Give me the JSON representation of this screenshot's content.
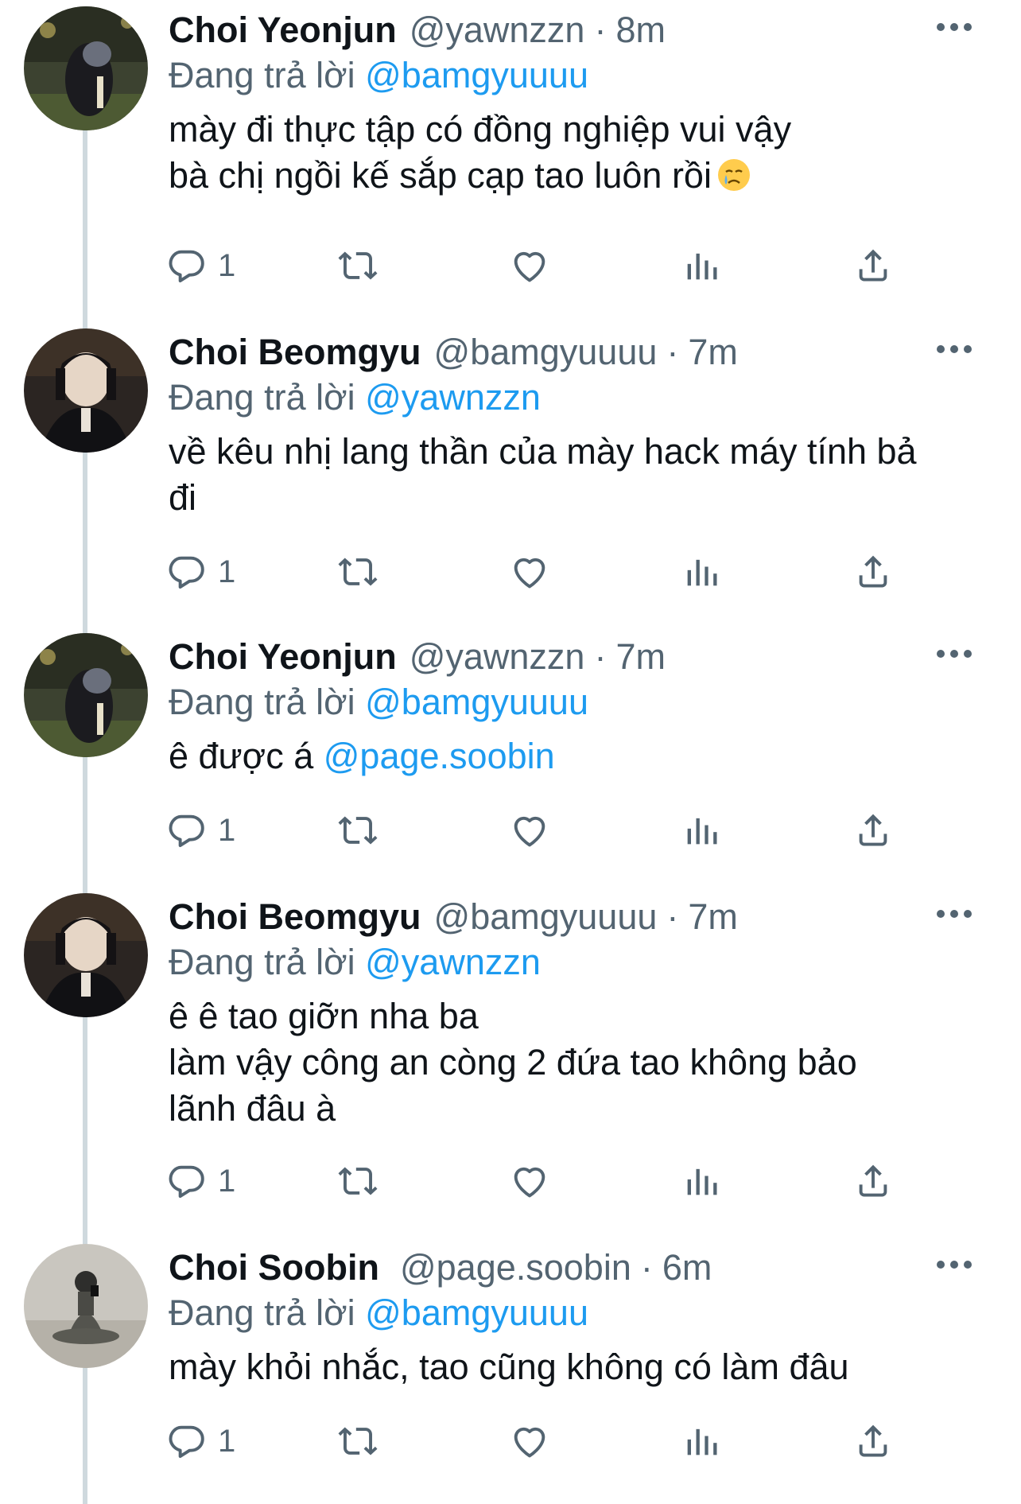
{
  "tweets": [
    {
      "name": "Choi Yeonjun",
      "handle": "@yawnzzn",
      "time": "8m",
      "reply_prefix": "Đang trả lời",
      "reply_to": "@bamgyuuuu",
      "lines": [
        "mày đi thực tập có đồng nghiệp vui vậy",
        "bà chị ngồi kế sắp cạp tao luôn rồi"
      ],
      "emoji": "crying-face",
      "replies": "1",
      "avatar": "yeonjun-avatar"
    },
    {
      "name": "Choi Beomgyu",
      "handle": "@bamgyuuuu",
      "time": "7m",
      "reply_prefix": "Đang trả lời",
      "reply_to": "@yawnzzn",
      "lines": [
        "về kêu nhị lang thần của mày hack máy tính bả",
        "đi"
      ],
      "replies": "1",
      "avatar": "beomgyu-avatar"
    },
    {
      "name": "Choi Yeonjun",
      "handle": "@yawnzzn",
      "time": "7m",
      "reply_prefix": "Đang trả lời",
      "reply_to": "@bamgyuuuu",
      "lines": [
        "ê được á"
      ],
      "inline_mention": "@page.soobin",
      "replies": "1",
      "avatar": "yeonjun-avatar"
    },
    {
      "name": "Choi Beomgyu",
      "handle": "@bamgyuuuu",
      "time": "7m",
      "reply_prefix": "Đang trả lời",
      "reply_to": "@yawnzzn",
      "lines": [
        "ê ê tao giỡn nha ba",
        "làm vậy công an còng 2 đứa tao không bảo",
        "lãnh đâu à"
      ],
      "replies": "1",
      "avatar": "beomgyu-avatar"
    },
    {
      "name": "Choi Soobin",
      "handle": "@page.soobin",
      "time": "6m",
      "reply_prefix": "Đang trả lời",
      "reply_to": "@bamgyuuuu",
      "lines": [
        "mày khỏi nhắc, tao cũng không có làm đâu"
      ],
      "replies": "1",
      "avatar": "soobin-avatar"
    }
  ],
  "colors": {
    "text": "#0f1419",
    "secondary": "#536471",
    "accent": "#1d9bf0",
    "thread_line": "#cfd9de"
  },
  "icons": [
    "reply-icon",
    "retweet-icon",
    "like-icon",
    "views-icon",
    "share-icon",
    "more-icon"
  ]
}
